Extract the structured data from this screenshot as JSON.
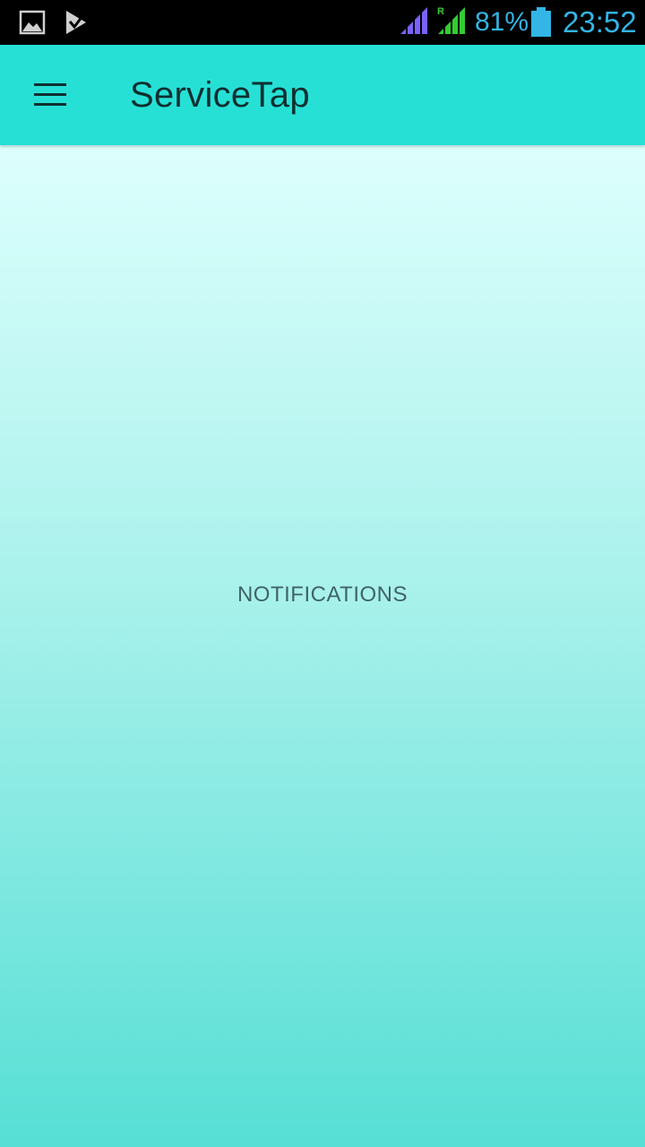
{
  "status_bar": {
    "icons": [
      "gallery-icon",
      "task-done-icon",
      "signal-icon",
      "roaming-signal-icon",
      "battery-icon"
    ],
    "roaming_indicator": "R",
    "battery_percent": "81%",
    "time": "23:52",
    "colors": {
      "text": "#33b5e5",
      "sim1_signal": "#7b61ff",
      "sim2_signal": "#33cc33"
    }
  },
  "app_bar": {
    "menu_icon": "hamburger-menu-icon",
    "title": "ServiceTap",
    "color": "#26e0d6"
  },
  "main": {
    "label": "NOTIFICATIONS",
    "gradient": [
      "#ddfffd",
      "#a8f1eb",
      "#56dfd5"
    ]
  }
}
